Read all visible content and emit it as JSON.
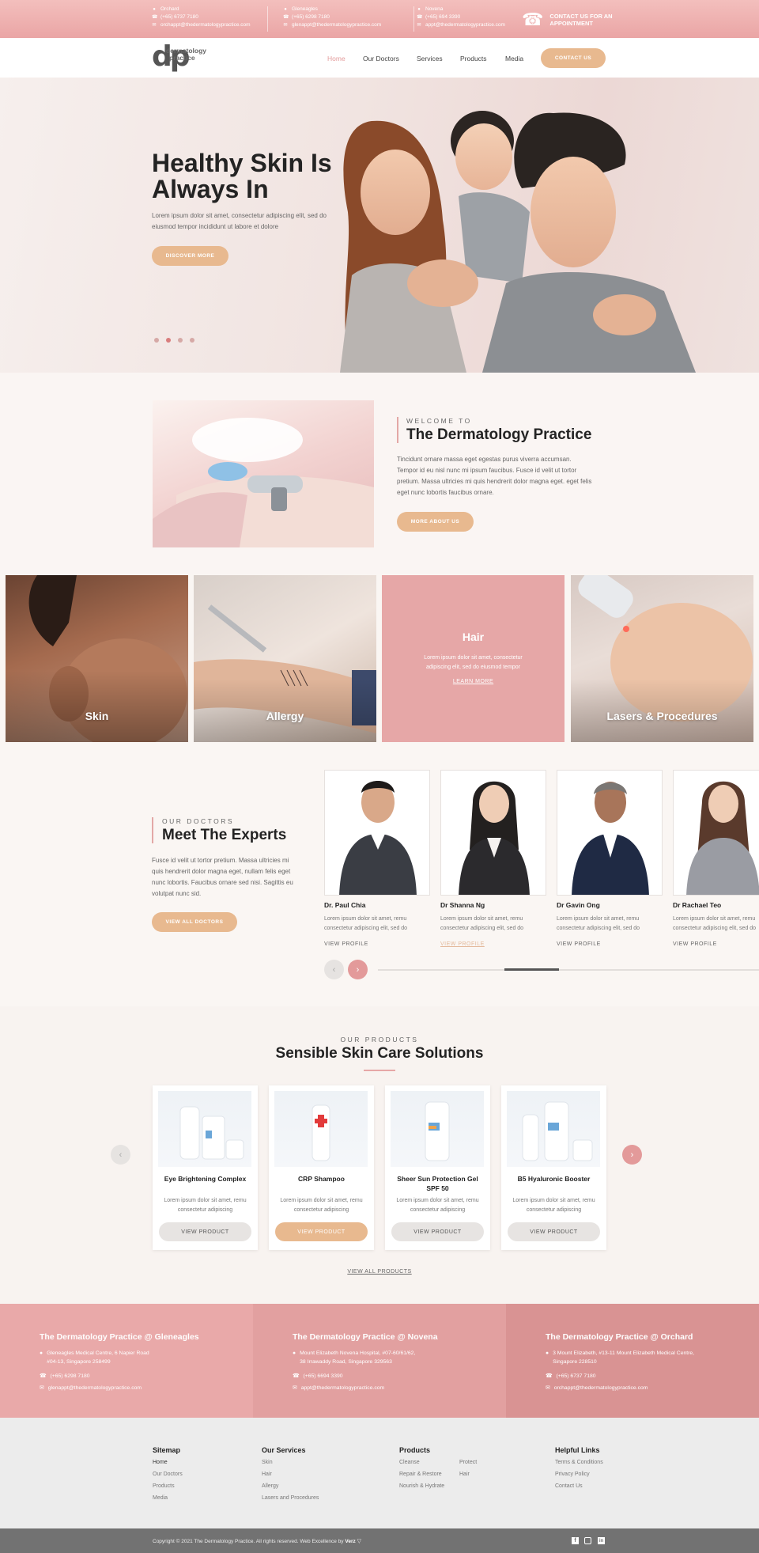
{
  "topbar": {
    "locations": [
      {
        "name": "Orchard",
        "phone": "(+65) 6737 7180",
        "email": "orchappt@thedermatologypractice.com"
      },
      {
        "name": "Gleneagles",
        "phone": "(+65) 6298 7180",
        "email": "glenappt@thedermatologypractice.com"
      },
      {
        "name": "Novena",
        "phone": "(+65) 694 3390",
        "email": "appt@thedermatologypractice.com"
      }
    ],
    "cta": "CONTACT US FOR AN APPOINTMENT"
  },
  "nav": {
    "logo_top": "dermatology",
    "logo_bottom": "practice",
    "items": [
      "Home",
      "Our Doctors",
      "Services",
      "Products",
      "Media"
    ],
    "contact": "CONTACT US"
  },
  "hero": {
    "title": "Healthy Skin Is Always In",
    "subtitle": "Lorem ipsum dolor sit amet, consectetur adipiscing elit, sed do eiusmod tempor incididunt ut labore et dolore",
    "button": "DISCOVER MORE"
  },
  "welcome": {
    "kicker": "WELCOME TO",
    "title": "The Dermatology Practice",
    "text": "Tincidunt ornare massa eget egestas purus viverra accumsan. Tempor id eu nisl nunc mi ipsum faucibus. Fusce id velit ut tortor pretium. Massa ultricies mi quis hendrerit dolor magna eget. eget felis eget nunc lobortis faucibus ornare.",
    "button": "MORE ABOUT US"
  },
  "services": [
    {
      "label": "Skin"
    },
    {
      "label": "Allergy"
    },
    {
      "label": "Hair",
      "text": "Lorem ipsum dolor sit amet, consectetur adipiscing elit, sed do eiusmod tempor",
      "link": "LEARN MORE"
    },
    {
      "label": "Lasers & Procedures"
    }
  ],
  "doctors": {
    "kicker": "OUR DOCTORS",
    "title": "Meet The Experts",
    "text": "Fusce id velit ut tortor pretium. Massa ultricies mi quis hendrerit dolor magna eget, nullam felis eget nunc lobortis. Faucibus ornare sed nisi. Sagittis eu volutpat nunc sid.",
    "button": "VIEW ALL DOCTORS",
    "list": [
      {
        "name": "Dr. Paul Chia",
        "desc": "Lorem ipsum dolor sit amet, remu consectetur adipiscing elit, sed do",
        "link": "VIEW PROFILE"
      },
      {
        "name": "Dr Shanna Ng",
        "desc": "Lorem ipsum dolor sit amet, remu consectetur adipiscing elit, sed do",
        "link": "VIEW PROFILE"
      },
      {
        "name": "Dr Gavin Ong",
        "desc": "Lorem ipsum dolor sit amet, remu consectetur adipiscing elit, sed do",
        "link": "VIEW PROFILE"
      },
      {
        "name": "Dr Rachael Teo",
        "desc": "Lorem ipsum dolor sit amet, remu consectetur adipiscing elit, sed do",
        "link": "VIEW PROFILE"
      }
    ],
    "prev": "‹",
    "next": "›"
  },
  "products": {
    "kicker": "OUR PRODUCTS",
    "title": "Sensible Skin Care Solutions",
    "list": [
      {
        "name": "Eye Brightening Complex",
        "desc": "Lorem ipsum dolor sit amet, remu consectetur adipiscing",
        "button": "VIEW PRODUCT"
      },
      {
        "name": "CRP Shampoo",
        "desc": "Lorem ipsum dolor sit amet, remu consectetur adipiscing",
        "button": "VIEW PRODUCT"
      },
      {
        "name": "Sheer Sun Protection Gel SPF 50",
        "desc": "Lorem ipsum dolor sit amet, remu consectetur adipiscing",
        "button": "VIEW PRODUCT"
      },
      {
        "name": "B5 Hyaluronic Booster",
        "desc": "Lorem ipsum dolor sit amet, remu consectetur adipiscing",
        "button": "VIEW PRODUCT"
      }
    ],
    "view_all": "VIEW ALL PRODUCTS",
    "prev": "‹",
    "next": "›"
  },
  "clinics": [
    {
      "title": "The Dermatology Practice @ Gleneagles",
      "address1": "Gleneagles Medical Centre, 6 Napier Road",
      "address2": "#04-13, Singapore 258499",
      "phone": "(+65) 6298 7180",
      "email": "glenappt@thedermatologypractice.com",
      "color": "#e9a9a9"
    },
    {
      "title": "The Dermatology Practice @ Novena",
      "address1": "Mount Elizabeth Novena Hospital, #07-60/61/62,",
      "address2": "38 Irrawaddy Road, Singapore 329563",
      "phone": "(+65) 6694 3390",
      "email": "appt@thedermatologypractice.com",
      "color": "#e2a0a0"
    },
    {
      "title": "The Dermatology Practice @ Orchard",
      "address1": "3 Mount Elizabeth, #13-11 Mount Elizabeth Medical Centre,",
      "address2": "Singapore 228510",
      "phone": "(+65) 6737 7180",
      "email": "orchappt@thedermatologypractice.com",
      "color": "#d99393"
    }
  ],
  "footer": {
    "sitemap_title": "Sitemap",
    "sitemap": [
      "Home",
      "Our Doctors",
      "Products",
      "Media"
    ],
    "services_title": "Our Services",
    "services": [
      "Skin",
      "Hair",
      "Allergy",
      "Lasers and Procedures"
    ],
    "products_title": "Products",
    "products_col1": [
      "Cleanse",
      "Repair & Restore",
      "Nourish & Hydrate"
    ],
    "products_col2": [
      "Protect",
      "Hair"
    ],
    "helpful_title": "Helpful Links",
    "helpful": [
      "Terms & Conditions",
      "Privacy Policy",
      "Contact Us"
    ],
    "copyright": "Copyright © 2021 The Dermatology Practice. All rights reserved. Web Excellence by",
    "agency": "Verz"
  },
  "colors": {
    "accent_pink": "#e9a9a9",
    "gold": "#e8b98f",
    "dark_text": "#232323"
  }
}
